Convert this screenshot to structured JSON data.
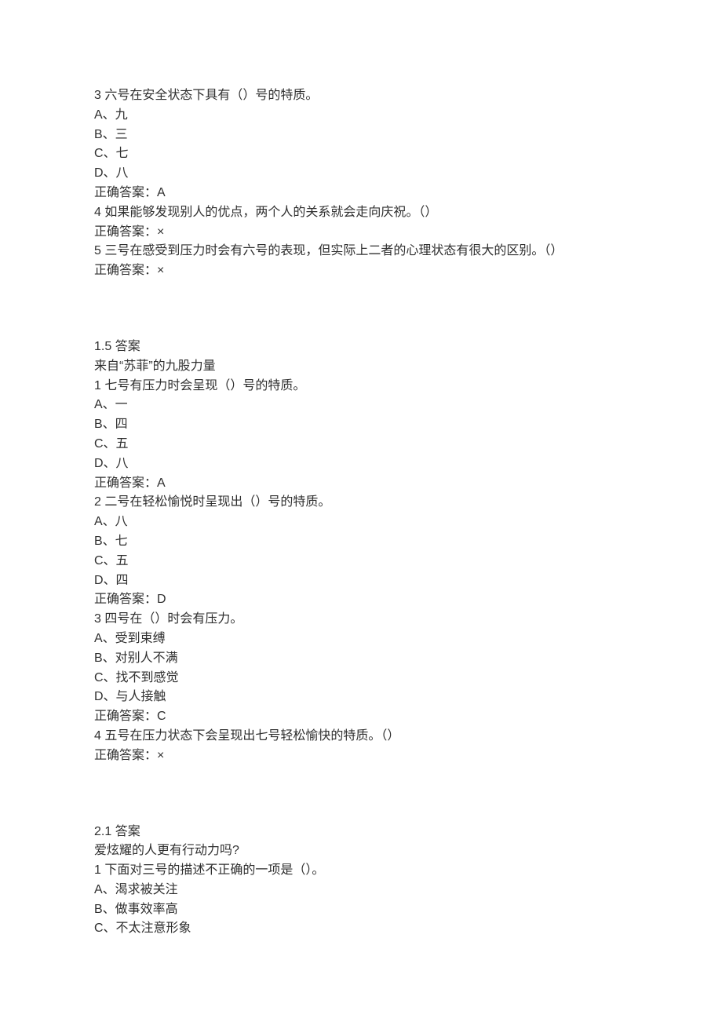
{
  "lines": {
    "l0": "3 六号在安全状态下具有（）号的特质。",
    "l1": "A、九",
    "l2": "B、三",
    "l3": "C、七",
    "l4": "D、八",
    "l5": "正确答案：A",
    "l6": "4 如果能够发现别人的优点，两个人的关系就会走向庆祝。（）",
    "l7": "正确答案：×",
    "l8": "5 三号在感受到压力时会有六号的表现，但实际上二者的心理状态有很大的区别。（）",
    "l9": "正确答案：×",
    "l10": "1.5 答案",
    "l11": "来自“苏菲”的九股力量",
    "l12": "1 七号有压力时会呈现（）号的特质。",
    "l13": "A、一",
    "l14": "B、四",
    "l15": "C、五",
    "l16": "D、八",
    "l17": "正确答案：A",
    "l18": "2 二号在轻松愉悦时呈现出（）号的特质。",
    "l19": "A、八",
    "l20": "B、七",
    "l21": "C、五",
    "l22": "D、四",
    "l23": "正确答案：D",
    "l24": "3 四号在（）时会有压力。",
    "l25": "A、受到束缚",
    "l26": "B、对别人不满",
    "l27": "C、找不到感觉",
    "l28": "D、与人接触",
    "l29": "正确答案：C",
    "l30": "4 五号在压力状态下会呈现出七号轻松愉快的特质。（）",
    "l31": "正确答案：×",
    "l32": "2.1 答案",
    "l33": "爱炫耀的人更有行动力吗?",
    "l34": "1 下面对三号的描述不正确的一项是（）。",
    "l35": "A、渴求被关注",
    "l36": "B、做事效率高",
    "l37": "C、不太注意形象"
  }
}
